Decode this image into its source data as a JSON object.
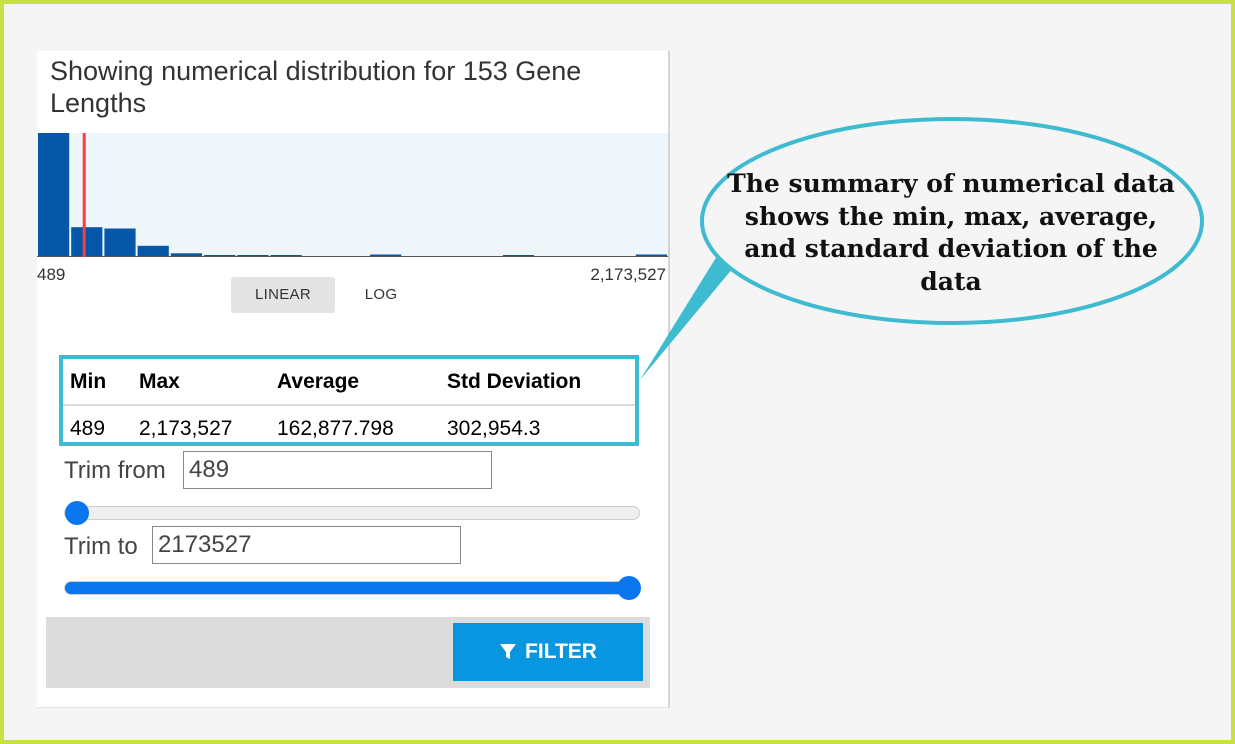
{
  "panel": {
    "title": "Showing numerical distribution for 153 Gene Lengths",
    "histogram": {
      "axis_min_label": "489",
      "axis_max_label": "2,173,527",
      "bar_color": "#0757a8",
      "marker_color": "#ff3b3b",
      "background_color": "#eef5fb"
    },
    "scale_buttons": [
      {
        "label": "LINEAR",
        "active": true
      },
      {
        "label": "LOG",
        "active": false
      }
    ],
    "stats": {
      "headers": [
        "Min",
        "Max",
        "Average",
        "Std Deviation"
      ],
      "values": [
        "489",
        "2,173,527",
        "162,877.798",
        "302,954.3"
      ]
    },
    "trim_from": {
      "label": "Trim from",
      "value": "489",
      "slider_fraction": 0.0
    },
    "trim_to": {
      "label": "Trim to",
      "value": "2173527",
      "slider_fraction": 1.0
    },
    "filter_button": {
      "label": "FILTER",
      "icon": "funnel-icon",
      "color": "#0996e0"
    }
  },
  "callout": {
    "text": "The summary of numerical data shows the min, max, average, and standard deviation of the data",
    "border_color": "#3ebbd1"
  },
  "chart_data": {
    "type": "bar",
    "title": "",
    "xlabel": "",
    "ylabel": "",
    "xlim": [
      489,
      2173527
    ],
    "bin_count": 19,
    "values": [
      100,
      24,
      23,
      9,
      3,
      1,
      1,
      1,
      0,
      0,
      2,
      0,
      0,
      0,
      1,
      0,
      0,
      0,
      2
    ],
    "marker_value": 162877.798,
    "marker_label": "Average"
  }
}
